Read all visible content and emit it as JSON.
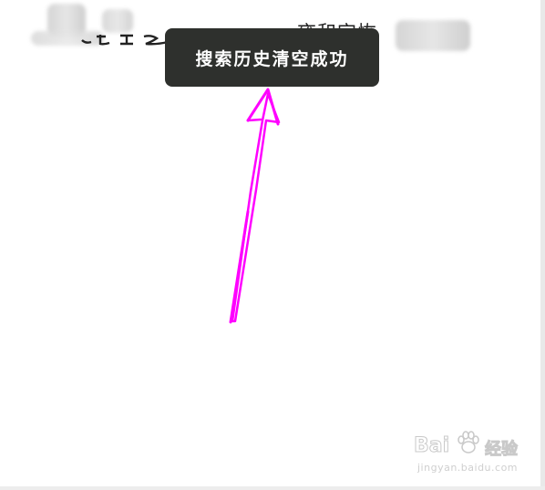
{
  "toast": {
    "message": "搜索历史清空成功"
  },
  "history": {
    "left_item": "",
    "right_item_visible": "雍和宫恢"
  },
  "annotation": {
    "color": "#ff00ff",
    "icon": "arrow-up-icon"
  },
  "watermark": {
    "logo": "Bai",
    "logo_tail": "经验",
    "url": "jingyan.baidu.com"
  },
  "colors": {
    "toast_bg": "#2e302d",
    "toast_text": "#ffffff",
    "background": "#ffffff"
  }
}
